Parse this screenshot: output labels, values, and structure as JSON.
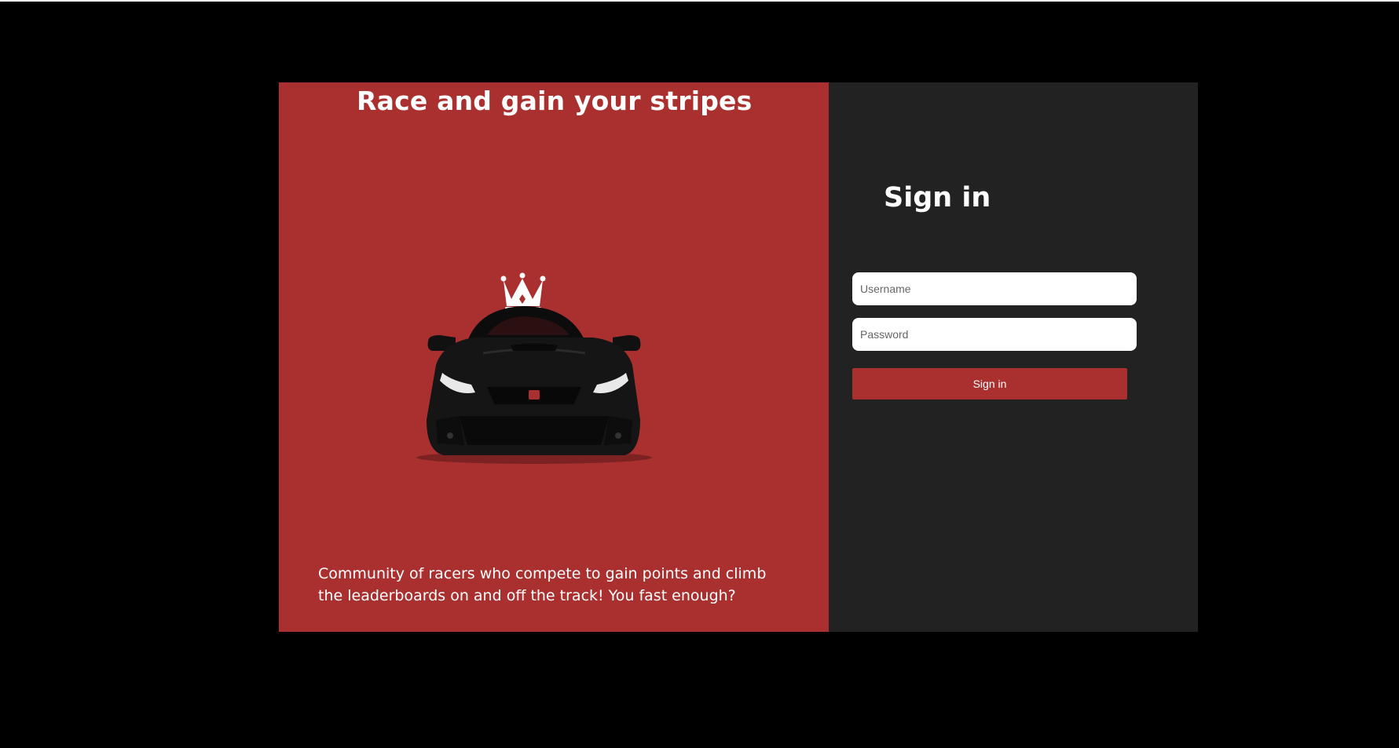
{
  "hero": {
    "title": "Race and gain your stripes",
    "description": "Community of racers who compete to gain points and climb the leaderboards on and off the track! You fast enough?",
    "image_icon": "crowned-sports-car"
  },
  "signin": {
    "title": "Sign in",
    "username_placeholder": "Username",
    "username_value": "",
    "password_placeholder": "Password",
    "password_value": "",
    "button_label": "Sign in"
  },
  "colors": {
    "page_background": "#000000",
    "brand_red": "#aa3030",
    "panel_dark": "#222222",
    "text": "#ffffff"
  }
}
